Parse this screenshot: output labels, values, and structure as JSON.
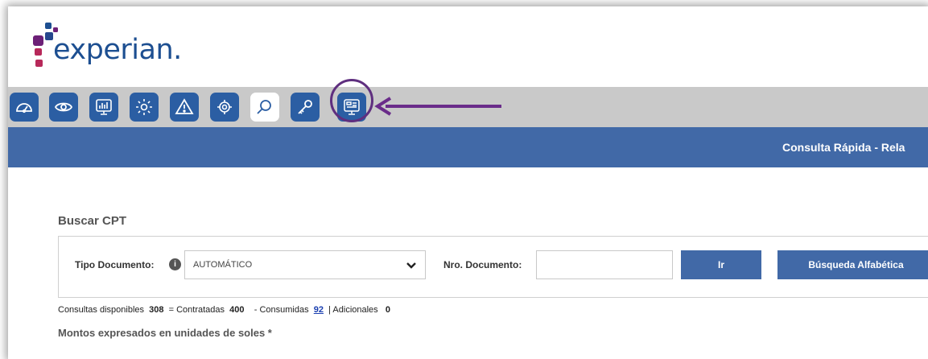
{
  "app": {
    "logo_text": "experian."
  },
  "colors": {
    "brand_blue": "#4169a7",
    "toolbar_gray": "#c9c9c9",
    "highlight_purple": "#5f2f7f"
  },
  "toolbar": {
    "buttons": [
      {
        "icon": "gauge-icon",
        "active": false
      },
      {
        "icon": "eye-icon",
        "active": false
      },
      {
        "icon": "chart-monitor-icon",
        "active": false
      },
      {
        "icon": "gear-icon",
        "active": false
      },
      {
        "icon": "warning-icon",
        "active": false
      },
      {
        "icon": "settings-gear-icon",
        "active": false
      },
      {
        "icon": "search-icon",
        "active": true
      },
      {
        "icon": "key-icon",
        "active": false
      },
      {
        "icon": "dashboard-monitor-icon",
        "active": false,
        "highlighted": true
      }
    ]
  },
  "header": {
    "title": "Consulta Rápida - Rela"
  },
  "search": {
    "section_title": "Buscar CPT",
    "tipo_label": "Tipo Documento:",
    "info_glyph": "i",
    "tipo_value": "AUTOMÁTICO",
    "nro_label": "Nro. Documento:",
    "nro_value": "",
    "ir_label": "Ir",
    "alfabetica_label": "Búsqueda Alfabética"
  },
  "stats": {
    "disponibles_label": "Consultas disponibles",
    "disponibles_value": "308",
    "contratadas_label": "= Contratadas",
    "contratadas_value": "400",
    "consumidas_label": "- Consumidas",
    "consumidas_value": "92",
    "adicionales_label": "| Adicionales",
    "adicionales_value": "0"
  },
  "note": "Montos expresados en unidades de soles *"
}
